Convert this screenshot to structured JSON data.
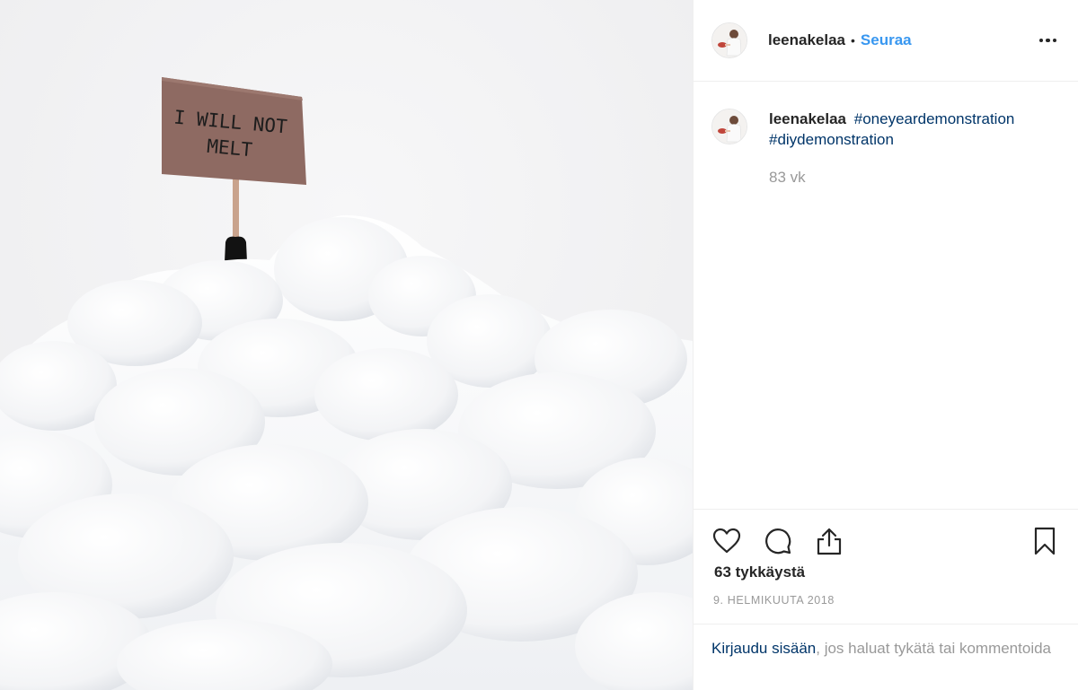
{
  "post": {
    "image": {
      "alt_subject": "snow-pile-with-protest-sign",
      "sign_text_line1": "I WILL NOT",
      "sign_text_line2": "MELT"
    },
    "header": {
      "username": "leenakelaa",
      "separator": "•",
      "follow_label": "Seuraa",
      "more_icon": "more-options-icon"
    },
    "caption": {
      "username": "leenakelaa",
      "hashtags": [
        "#oneyeardemonstration",
        "#diydemonstration"
      ],
      "age": "83 vk"
    },
    "actions": {
      "like_icon": "heart-icon",
      "comment_icon": "comment-bubble-icon",
      "share_icon": "share-icon",
      "save_icon": "bookmark-icon"
    },
    "likes": "63 tykkäystä",
    "date": "9. HELMIKUUTA 2018",
    "login": {
      "link_text": "Kirjaudu sisään",
      "rest_text": ", jos haluat tykätä tai kommentoida"
    },
    "colors": {
      "link_blue": "#3897f0",
      "hashtag_navy": "#003569",
      "muted_gray": "#999999",
      "text_dark": "#262626",
      "border": "#efefef",
      "sign_brown": "#8e6a62"
    }
  }
}
